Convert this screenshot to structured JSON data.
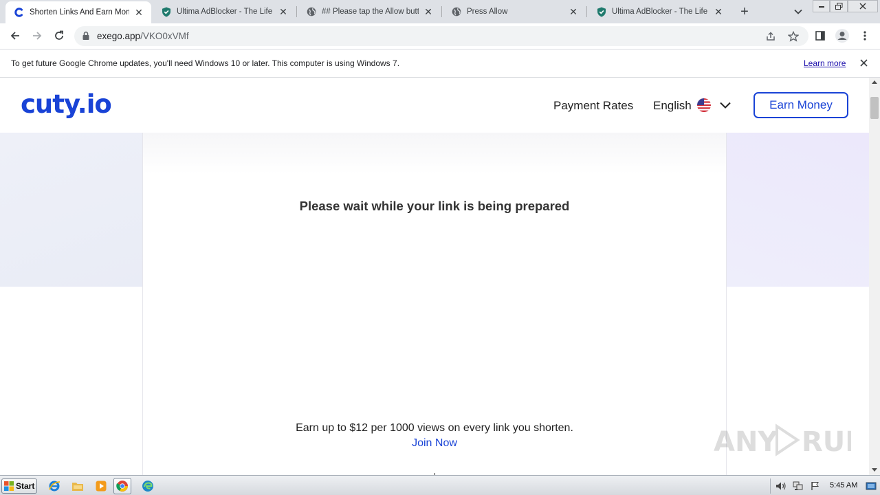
{
  "browser": {
    "tabs": [
      {
        "title": "Shorten Links And Earn Money",
        "favicon": "cuty-icon",
        "active": true
      },
      {
        "title": "Ultima AdBlocker - The Life without Ads",
        "favicon": "shield-icon",
        "active": false
      },
      {
        "title": "## Please tap the Allow button",
        "favicon": "globe-icon",
        "active": false
      },
      {
        "title": "Press Allow",
        "favicon": "globe-icon",
        "active": false
      },
      {
        "title": "Ultima AdBlocker - The Life without Ads",
        "favicon": "shield-icon",
        "active": false
      }
    ],
    "url_host": "exego.app",
    "url_path": "/VKO0xVMf",
    "infobar": {
      "message": "To get future Google Chrome updates, you'll need Windows 10 or later. This computer is using Windows 7.",
      "link": "Learn more"
    }
  },
  "site": {
    "logo": "cuty.io",
    "nav": {
      "payment_rates": "Payment Rates",
      "language": "English",
      "earn_money": "Earn Money"
    },
    "wait_title": "Please wait while your link is being prepared",
    "earn_text": "Earn up to $12 per 1000 views on every link you shorten.",
    "join_now": "Join Now",
    "watermark": "ANY RUN"
  },
  "taskbar": {
    "start_label": "Start",
    "clock": "5:45 AM"
  },
  "colors": {
    "brand": "#1943d6",
    "tabstrip": "#dee1e6"
  }
}
